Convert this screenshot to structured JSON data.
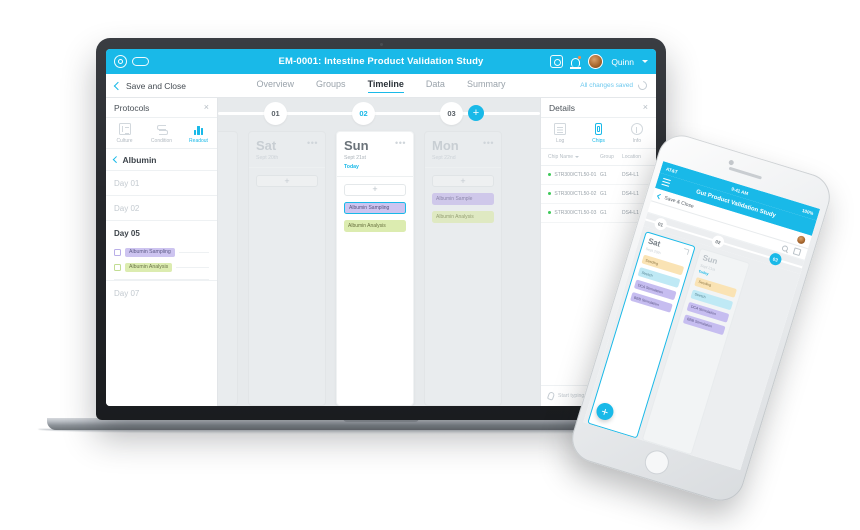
{
  "topbar": {
    "app_title": "EM-0001: Intestine Product Validation Study",
    "user_name": "Quinn",
    "icons": {
      "logo": "logo-icon",
      "help": "help-icon",
      "bell": "bell-icon",
      "avatar": "avatar"
    }
  },
  "nav": {
    "save_close": "Save and Close",
    "tabs": [
      {
        "label": "Overview",
        "active": false
      },
      {
        "label": "Groups",
        "active": false
      },
      {
        "label": "Timeline",
        "active": true
      },
      {
        "label": "Data",
        "active": false
      },
      {
        "label": "Summary",
        "active": false
      }
    ],
    "saved_status": "All changes saved"
  },
  "protocols": {
    "title": "Protocols",
    "close": "×",
    "tabs": [
      {
        "label": "Culture",
        "active": false
      },
      {
        "label": "Condition",
        "active": false
      },
      {
        "label": "Readout",
        "active": true
      }
    ],
    "breadcrumb": "Albumin",
    "days": [
      {
        "label": "Day 01",
        "active": false,
        "tasks": []
      },
      {
        "label": "Day 02",
        "active": false,
        "tasks": []
      },
      {
        "label": "Day 05",
        "active": true,
        "tasks": [
          {
            "label": "Albumin Sampling",
            "color": "purple",
            "checked": false
          },
          {
            "label": "Albumin Analysis",
            "color": "green",
            "checked": false
          }
        ]
      },
      {
        "label": "Day 07",
        "active": false,
        "tasks": []
      }
    ]
  },
  "timeline": {
    "nodes": [
      {
        "label": "01",
        "active": false
      },
      {
        "label": "02",
        "active": true
      },
      {
        "label": "03",
        "active": false
      }
    ],
    "add_node": "+",
    "cards": [
      {
        "day": "Sat",
        "date": "Sept 20th",
        "today_label": "",
        "is_today": false,
        "menu": "•••",
        "add": "+",
        "tasks": []
      },
      {
        "day": "Sun",
        "date": "Sept 21st",
        "today_label": "Today",
        "is_today": true,
        "menu": "•••",
        "add": "+",
        "tasks": [
          {
            "label": "Albumin Sampling",
            "color": "purple",
            "selected": true
          },
          {
            "label": "Albumin Analysis",
            "color": "green",
            "selected": false
          }
        ]
      },
      {
        "day": "Mon",
        "date": "Sept 22nd",
        "today_label": "",
        "is_today": false,
        "menu": "•••",
        "add": "+",
        "tasks": [
          {
            "label": "Albumin Sample",
            "color": "dim-purple",
            "selected": false
          },
          {
            "label": "Albumin Analysis",
            "color": "dim-green",
            "selected": false
          }
        ]
      }
    ]
  },
  "details": {
    "title": "Details",
    "close": "×",
    "tabs": [
      {
        "label": "Log",
        "active": false
      },
      {
        "label": "Chips",
        "active": true
      },
      {
        "label": "Info",
        "active": false
      }
    ],
    "columns": [
      "Chip Name",
      "Group",
      "Location"
    ],
    "rows": [
      {
        "name": "STR300/CTL50-01",
        "group": "G1",
        "location": "DS4-L1",
        "status": "active"
      },
      {
        "name": "STR300/CTL50-02",
        "group": "G1",
        "location": "DS4-L1",
        "status": "active"
      },
      {
        "name": "STR300/CTL50-03",
        "group": "G1",
        "location": "DS4-L1",
        "status": "active"
      }
    ],
    "note_placeholder": "Start typing a note...",
    "add_button": "+"
  },
  "phone": {
    "status": {
      "carrier": "AT&T",
      "time": "9:41 AM",
      "battery": "100%"
    },
    "app_title": "Gut Product Validation Study",
    "save_close": "Save & Close",
    "nodes": [
      {
        "label": "01",
        "active": false
      },
      {
        "label": "02",
        "active": false
      },
      {
        "label": "03",
        "active": true
      }
    ],
    "cards": [
      {
        "day": "Sat",
        "date": "Sept 20th",
        "today_label": "",
        "selected": true,
        "tasks": [
          {
            "label": "Seeding",
            "color": "amber"
          },
          {
            "label": "Stretch",
            "color": "cyan"
          },
          {
            "label": "DCA Stimulation",
            "color": "violet"
          },
          {
            "label": "BBB Stimulation",
            "color": "violet"
          }
        ]
      },
      {
        "day": "Sun",
        "date": "Sept 21st",
        "today_label": "Today",
        "selected": false,
        "tasks": [
          {
            "label": "Seeding",
            "color": "amber"
          },
          {
            "label": "Stretch",
            "color": "cyan"
          },
          {
            "label": "DCA Stimulation",
            "color": "violet"
          },
          {
            "label": "BBB Stimulation",
            "color": "violet"
          }
        ]
      }
    ],
    "fab": "+"
  },
  "colors": {
    "brand": "#19b9e8",
    "purple": "#cdc4f0",
    "green": "#dcecb0",
    "status_green": "#3ec95a",
    "amber": "#fae3b4",
    "cyan": "#bfe9f5",
    "violet": "#c6bdf0"
  }
}
